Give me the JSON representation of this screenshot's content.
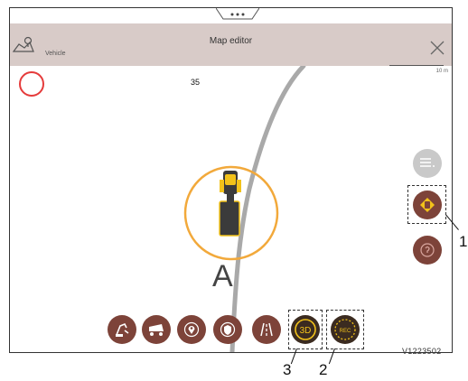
{
  "header": {
    "title": "Map editor",
    "subtitle": "Vehicle"
  },
  "map": {
    "speed_value": "35",
    "scale_label": "10 m",
    "track_letter": "A"
  },
  "bottom_toolbar": {
    "record_label": "REC",
    "view3d_label": "3D"
  },
  "callouts": [
    "1",
    "2",
    "3"
  ],
  "figure_id": "V1223502",
  "colors": {
    "titlebar": "#d8cbc8",
    "button_fill": "#7d4339",
    "accent_yellow": "#f2c21a",
    "machine_ring": "#f2a93b",
    "record_circle": "#e53b3b",
    "track_line": "#a9a9a9"
  },
  "icons": {
    "header": "map-pin-icon",
    "close": "close-icon",
    "side": [
      "layers-menu-icon",
      "machine-center-icon",
      "help-icon"
    ],
    "bottom": [
      "excavator-icon",
      "dump-truck-icon",
      "location-pin-icon",
      "shield-icon",
      "road-icon",
      "view-3d-icon",
      "record-icon"
    ]
  }
}
